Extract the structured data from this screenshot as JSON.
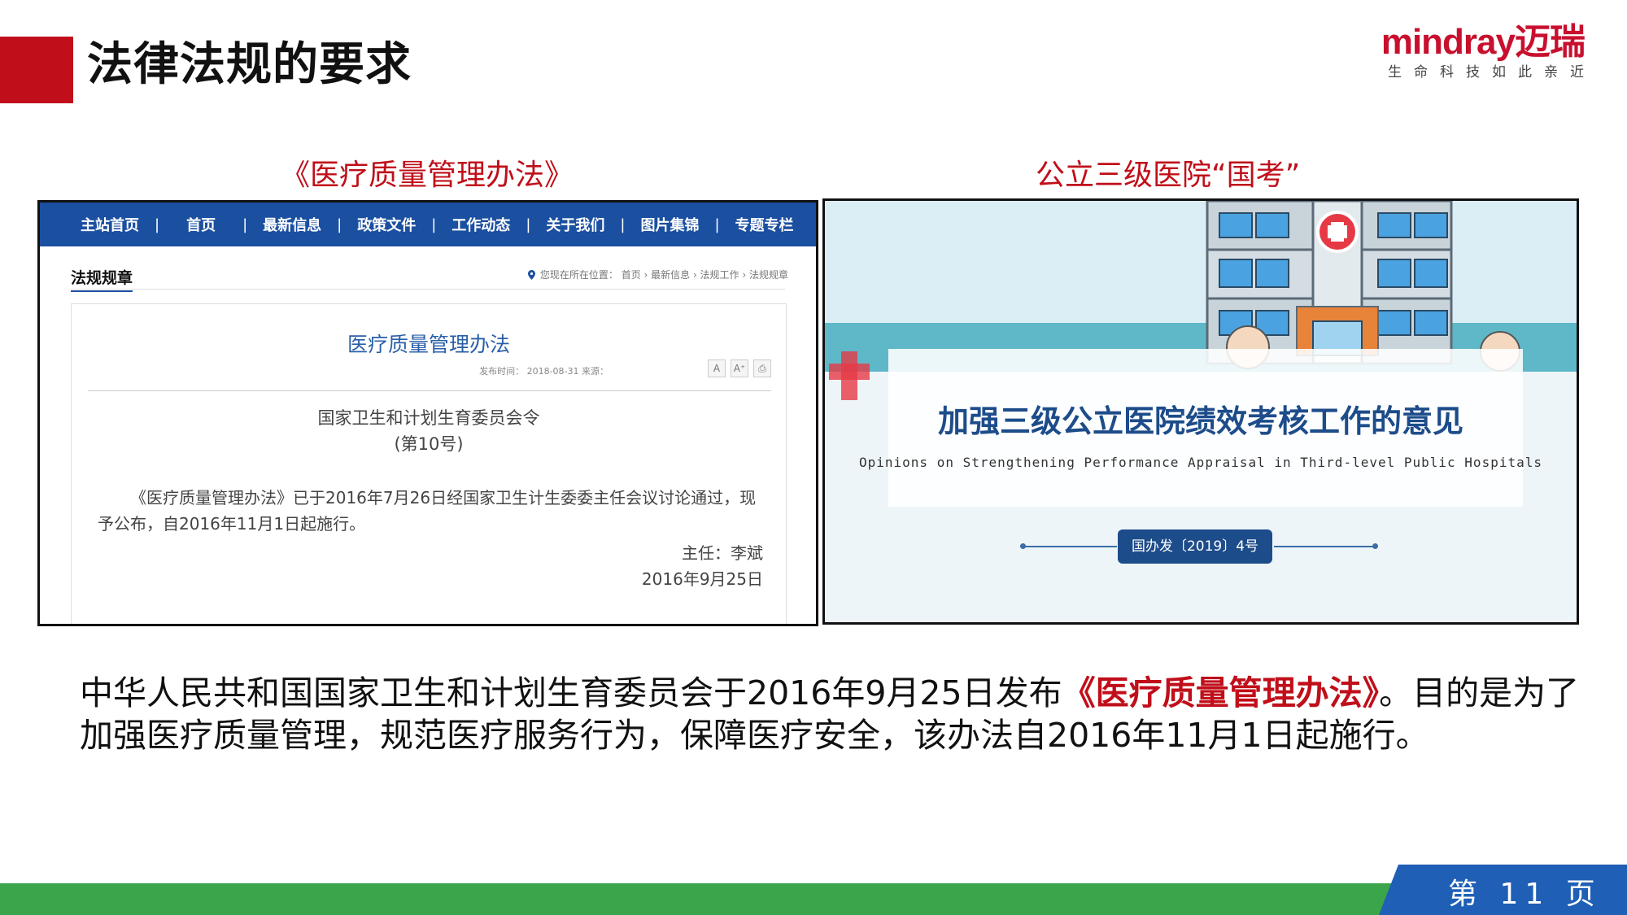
{
  "header": {
    "title": "法律法规的要求",
    "logo_text": "mindray迈瑞",
    "logo_slogan": "生命科技如此亲近"
  },
  "left_panel": {
    "caption": "《医疗质量管理办法》",
    "nav_items": [
      "主站首页",
      "首页",
      "最新信息",
      "政策文件",
      "工作动态",
      "关于我们",
      "图片集锦",
      "专题专栏"
    ],
    "nav_separator": "|",
    "section_title": "法规规章",
    "breadcrumb": "您现在所在位置： 首页 › 最新信息 › 法规工作 › 法规规章",
    "doc_title": "医疗质量管理办法",
    "doc_meta": "发布时间： 2018-08-31   来源：",
    "tools": [
      "A",
      "A⁺",
      "⎙"
    ],
    "issuer": "国家卫生和计划生育委员会令",
    "order_no": "(第10号)",
    "body": "《医疗质量管理办法》已于2016年7月26日经国家卫生计生委委主任会议讨论通过，现予公布，自2016年11月1日起施行。",
    "sign_role": "主任：李斌",
    "sign_date": "2016年9月25日"
  },
  "right_panel": {
    "caption": "公立三级医院“国考”",
    "title": "加强三级公立医院绩效考核工作的意见",
    "subtitle": "Opinions on Strengthening Performance Appraisal in Third-level Public Hospitals",
    "doc_number": "国办发〔2019〕4号"
  },
  "description": {
    "part1": "中华人民共和国国家卫生和计划生育委员会于2016年9月25日发布",
    "highlight": "《医疗质量管理办法》",
    "part2": "。目的是为了加强医疗质量管理，规范医疗服务行为，保障医疗安全，该办法自2016年11月1日起施行。"
  },
  "footer": {
    "page_label": "第 11 页"
  },
  "colors": {
    "brand_red": "#c00f1a",
    "nav_blue": "#1b4fa0",
    "footer_green": "#3aa54a",
    "footer_blue": "#1f5fb5"
  }
}
